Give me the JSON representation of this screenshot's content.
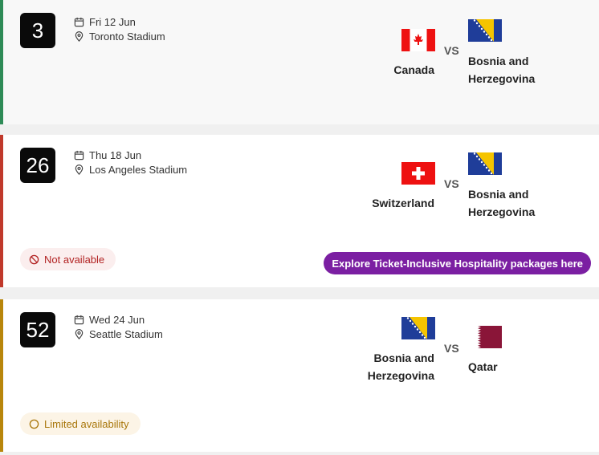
{
  "matches": [
    {
      "number": "3",
      "date": "Fri 12 Jun",
      "venue": "Toronto Stadium",
      "home": {
        "name": "Canada",
        "flag": "canada-flag-icon"
      },
      "vs": "VS",
      "away": {
        "name_line1": "Bosnia and",
        "name_line2": "Herzegovina",
        "flag": "bosnia-flag-icon"
      },
      "accent": "#2e8b57"
    },
    {
      "number": "26",
      "date": "Thu 18 Jun",
      "venue": "Los Angeles Stadium",
      "home": {
        "name": "Switzerland",
        "flag": "switzerland-flag-icon"
      },
      "vs": "VS",
      "away": {
        "name_line1": "Bosnia and",
        "name_line2": "Herzegovina",
        "flag": "bosnia-flag-icon"
      },
      "status": "Not available",
      "status_color": "#b22222",
      "hospitality_label": "Explore Ticket-Inclusive Hospitality packages here",
      "accent": "#c0392b"
    },
    {
      "number": "52",
      "date": "Wed 24 Jun",
      "venue": "Seattle Stadium",
      "home": {
        "name_line1": "Bosnia and",
        "name_line2": "Herzegovina",
        "flag": "bosnia-flag-icon"
      },
      "vs": "VS",
      "away": {
        "name": "Qatar",
        "flag": "qatar-flag-icon"
      },
      "status": "Limited availability",
      "status_color": "#a8760a",
      "accent": "#b8860b"
    }
  ],
  "colors": {
    "hospitality_button": "#7b1fa2"
  }
}
